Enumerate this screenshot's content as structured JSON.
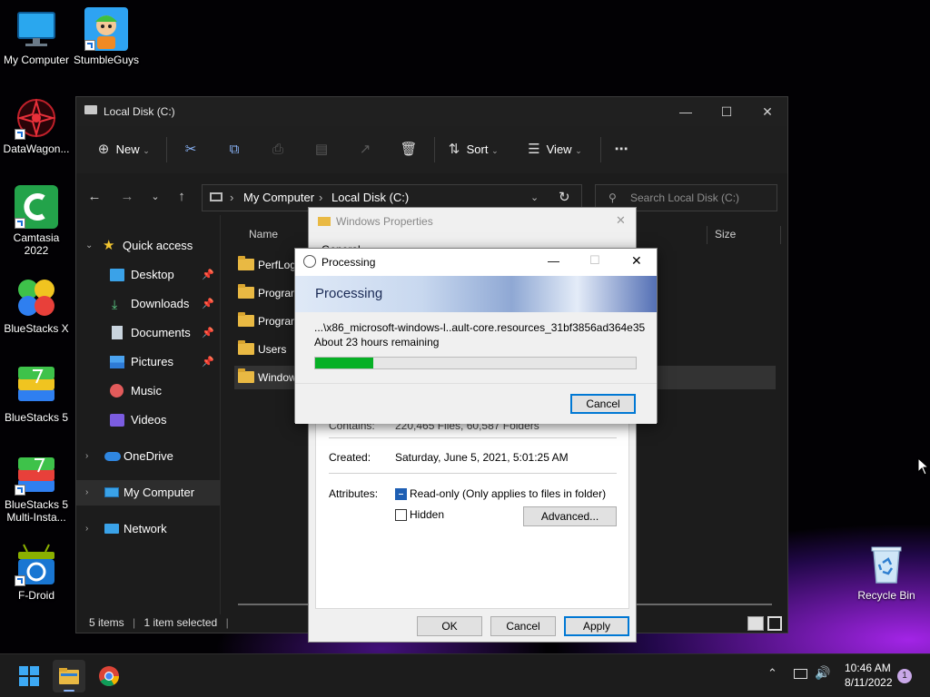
{
  "desktop": {
    "icons": [
      {
        "label": "My Computer"
      },
      {
        "label": "StumbleGuys"
      },
      {
        "label": "DataWagon..."
      },
      {
        "label": "Camtasia 2022"
      },
      {
        "label": "BlueStacks X"
      },
      {
        "label": "BlueStacks 5"
      },
      {
        "label": "BlueStacks 5 Multi-Insta..."
      },
      {
        "label": "F-Droid"
      },
      {
        "label": "Recycle Bin"
      }
    ]
  },
  "explorer": {
    "title": "Local Disk (C:)",
    "toolbar": {
      "new_label": "New",
      "sort_label": "Sort",
      "view_label": "View"
    },
    "address": {
      "part1": "My Computer",
      "part2": "Local Disk (C:)"
    },
    "search_placeholder": "Search Local Disk (C:)",
    "nav": {
      "quick_access": "Quick access",
      "items": [
        {
          "label": "Desktop"
        },
        {
          "label": "Downloads"
        },
        {
          "label": "Documents"
        },
        {
          "label": "Pictures"
        },
        {
          "label": "Music"
        },
        {
          "label": "Videos"
        }
      ],
      "onedrive": "OneDrive",
      "my_computer": "My Computer",
      "network": "Network"
    },
    "columns": {
      "name": "Name",
      "size": "Size"
    },
    "files": [
      {
        "name": "PerfLog"
      },
      {
        "name": "Program"
      },
      {
        "name": "Program"
      },
      {
        "name": "Users"
      },
      {
        "name": "Window"
      }
    ],
    "status": {
      "items": "5 items",
      "selected": "1 item selected"
    }
  },
  "properties": {
    "title": "Windows Properties",
    "tab_partial": "General",
    "contains_label": "Contains:",
    "contains_value": "220,465 Files, 60,587 Folders",
    "created_label": "Created:",
    "created_value": "Saturday, June 5, 2021, 5:01:25 AM",
    "attributes_label": "Attributes:",
    "readonly_label": "Read-only (Only applies to files in folder)",
    "hidden_label": "Hidden",
    "advanced_label": "Advanced...",
    "ok_label": "OK",
    "cancel_label": "Cancel",
    "apply_label": "Apply"
  },
  "processing": {
    "title": "Processing",
    "header": "Processing",
    "file": "...\\x86_microsoft-windows-l..ault-core.resources_31bf3856ad364e35",
    "remaining": "About 23 hours remaining",
    "progress": 0.18,
    "cancel_label": "Cancel"
  },
  "taskbar": {
    "time": "10:46 AM",
    "date": "8/11/2022",
    "notification_count": "1"
  },
  "colors": {
    "progress_fill": "#06b025",
    "accent": "#0078d4",
    "folder": "#e9b943"
  }
}
